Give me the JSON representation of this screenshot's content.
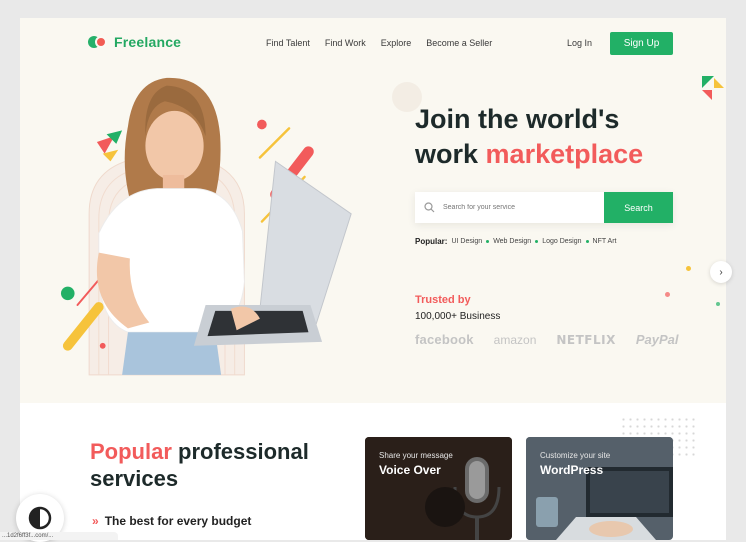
{
  "header": {
    "brand": "Freelance",
    "nav": [
      "Find Talent",
      "Find Work",
      "Explore",
      "Become a Seller"
    ],
    "login": "Log In",
    "signup": "Sign Up"
  },
  "hero": {
    "headline_line1": "Join the world's",
    "headline_line2_prefix": "work",
    "headline_line2_accent": "marketplace",
    "search_placeholder": "Search for your service",
    "search_button": "Search",
    "popular_label": "Popular:",
    "popular_tags": [
      "UI Design",
      "Web Design",
      "Logo Design",
      "NFT Art"
    ],
    "trusted_label": "Trusted by",
    "business_count": "100,000+ Business",
    "brands": [
      "facebook",
      "amazon",
      "NETFLIX",
      "PayPal"
    ]
  },
  "services": {
    "title_accent": "Popular",
    "title_rest": "professional",
    "title_line2": "services",
    "tagline": "The best for every budget",
    "cards": [
      {
        "subtitle": "Share your message",
        "title": "Voice Over"
      },
      {
        "subtitle": "Customize your site",
        "title": "WordPress"
      }
    ]
  },
  "icons": {
    "next": "chevron-right-icon",
    "search": "search-icon",
    "theme": "contrast-icon",
    "tagline": "double-chevron-right-icon"
  },
  "colors": {
    "brand_green": "#22b066",
    "accent_red": "#f25b5b",
    "deco_yellow": "#f6c33b"
  },
  "status": {
    "url": "...1d2f6ff3f...com/..."
  }
}
